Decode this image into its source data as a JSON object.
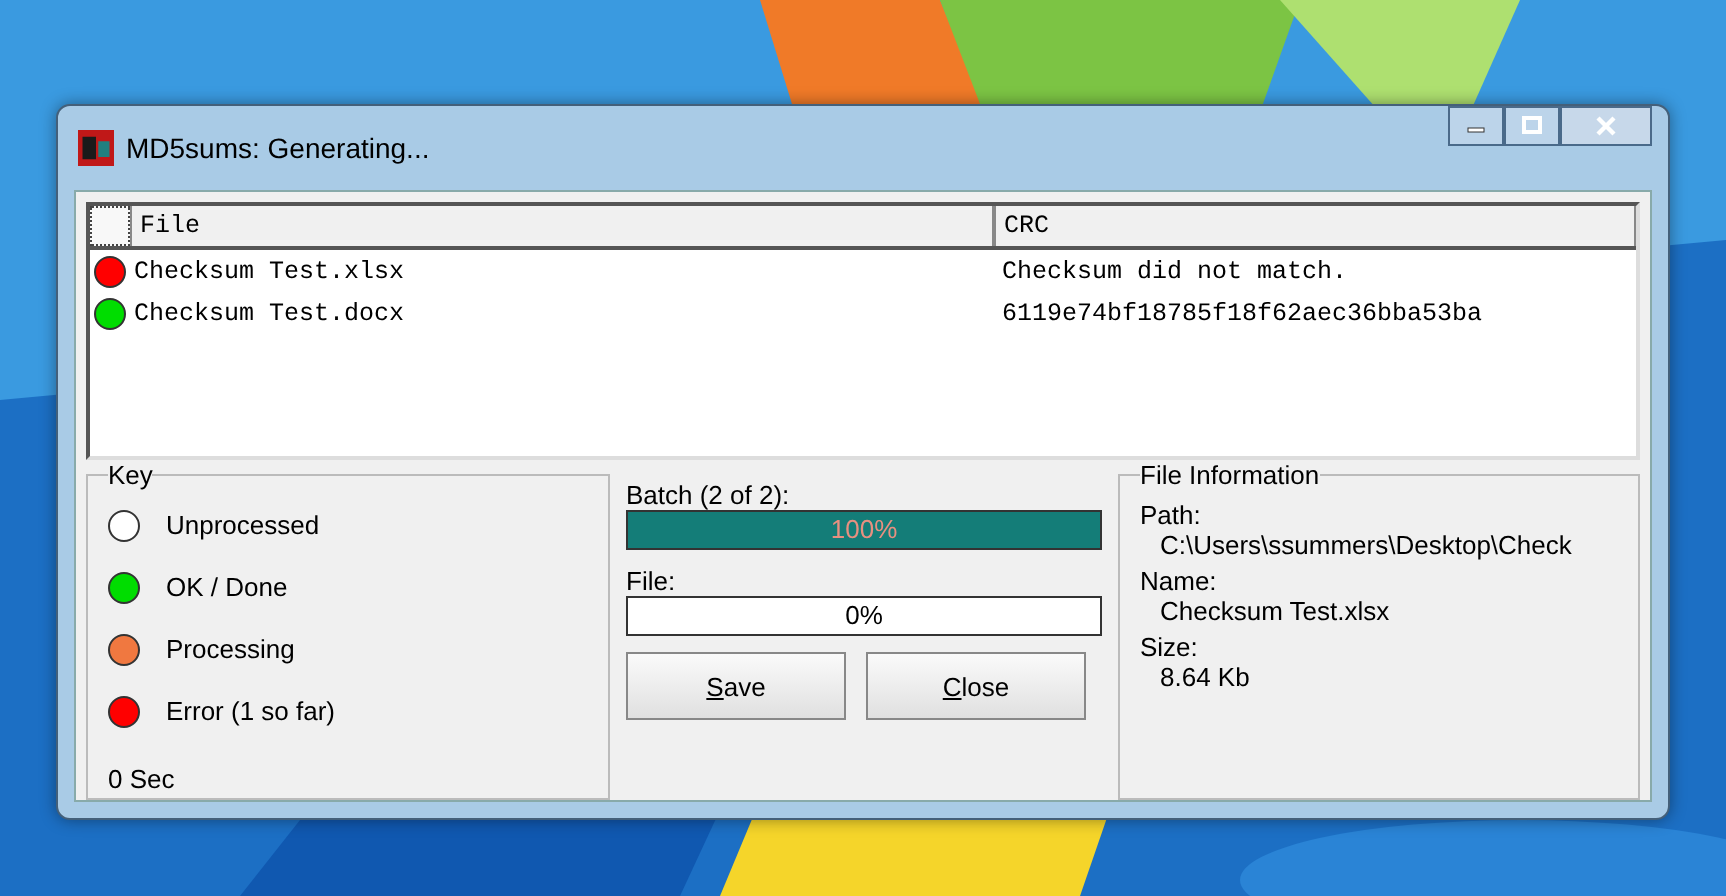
{
  "window": {
    "title": "MD5sums: Generating..."
  },
  "table": {
    "header_checkbox": {
      "checked": false
    },
    "columns": [
      "File",
      "CRC"
    ],
    "rows": [
      {
        "color": "#ff0000",
        "file": "Checksum Test.xlsx",
        "crc": "Checksum did not match."
      },
      {
        "color": "#00dd00",
        "file": "Checksum Test.docx",
        "crc": "6119e74bf18785f18f62aec36bba53ba"
      }
    ]
  },
  "key": {
    "title": "Key",
    "items": [
      {
        "color": "#ffffff",
        "label": "Unprocessed"
      },
      {
        "color": "#00dd00",
        "label": "OK / Done"
      },
      {
        "color": "#f07840",
        "label": "Processing"
      },
      {
        "color": "#ff0000",
        "label": "Error  (1 so far)"
      }
    ],
    "elapsed": "0 Sec"
  },
  "progress": [
    {
      "label": "Batch (2 of 2):",
      "level": 1,
      "reading": "100%"
    },
    {
      "label": "File:",
      "level": 0,
      "reading": "0%"
    }
  ],
  "buttons": [
    "Save",
    "Close"
  ],
  "file_info": {
    "title": "File Information",
    "fields": [
      {
        "label": "Path:",
        "value": "C:\\Users\\ssummers\\Desktop\\Check"
      },
      {
        "label": "Name:",
        "value": "Checksum Test.xlsx"
      },
      {
        "label": "Size:",
        "value": "8.64 Kb"
      }
    ]
  }
}
